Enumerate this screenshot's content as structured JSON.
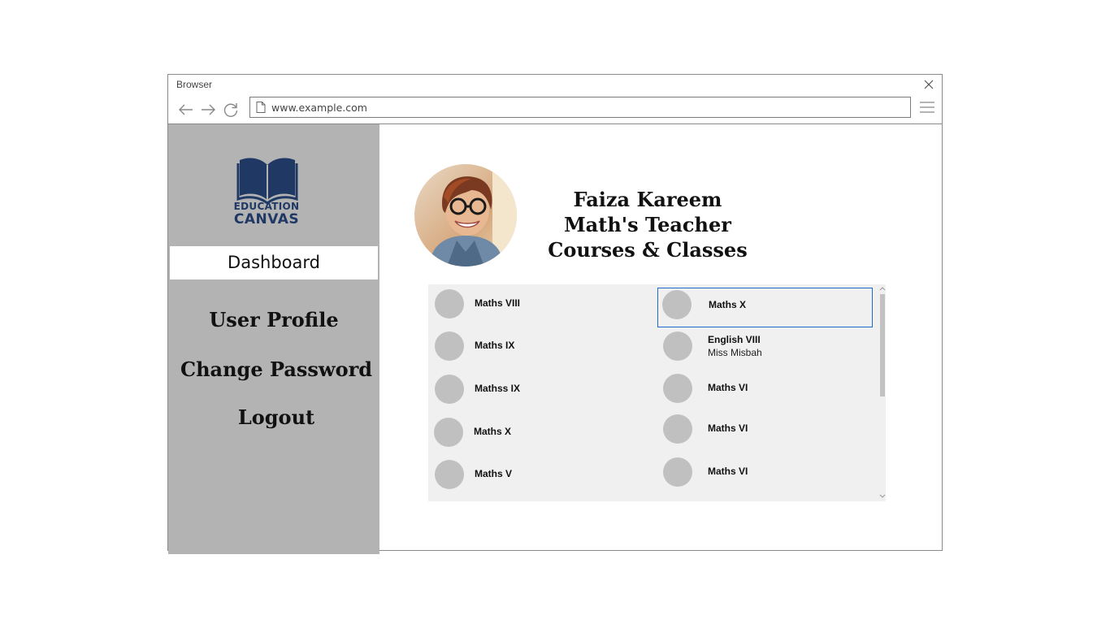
{
  "window": {
    "title": "Browser",
    "url": "www.example.com",
    "icons": [
      "close-icon",
      "back-arrow-icon",
      "forward-arrow-icon",
      "refresh-icon",
      "page-icon",
      "hamburger-menu-icon"
    ]
  },
  "sidebar": {
    "logo": {
      "line1": "EDUCATION",
      "line2": "CANVAS",
      "icon": "open-book-icon",
      "color": "#1f3864"
    },
    "dashboard_label": "Dashboard",
    "links": [
      {
        "label": "User Profile"
      },
      {
        "label": "Change Password"
      },
      {
        "label": "Logout"
      }
    ],
    "background": "#b3b3b3"
  },
  "profile": {
    "name": "Faiza Kareem",
    "role": "Math's Teacher",
    "section_title": "Courses & Classes"
  },
  "courses": {
    "left": [
      {
        "name": "Maths VIII"
      },
      {
        "name": "Maths IX"
      },
      {
        "name": "Mathss IX"
      },
      {
        "name": "Maths X"
      },
      {
        "name": "Maths V"
      }
    ],
    "right": [
      {
        "name": "Maths X",
        "selected": true
      },
      {
        "name": "English VIII",
        "teacher": "Miss Misbah"
      },
      {
        "name": "Maths VI"
      },
      {
        "name": "Maths VI"
      },
      {
        "name": "Maths VI"
      }
    ],
    "selection_color": "#1e6bcf"
  }
}
